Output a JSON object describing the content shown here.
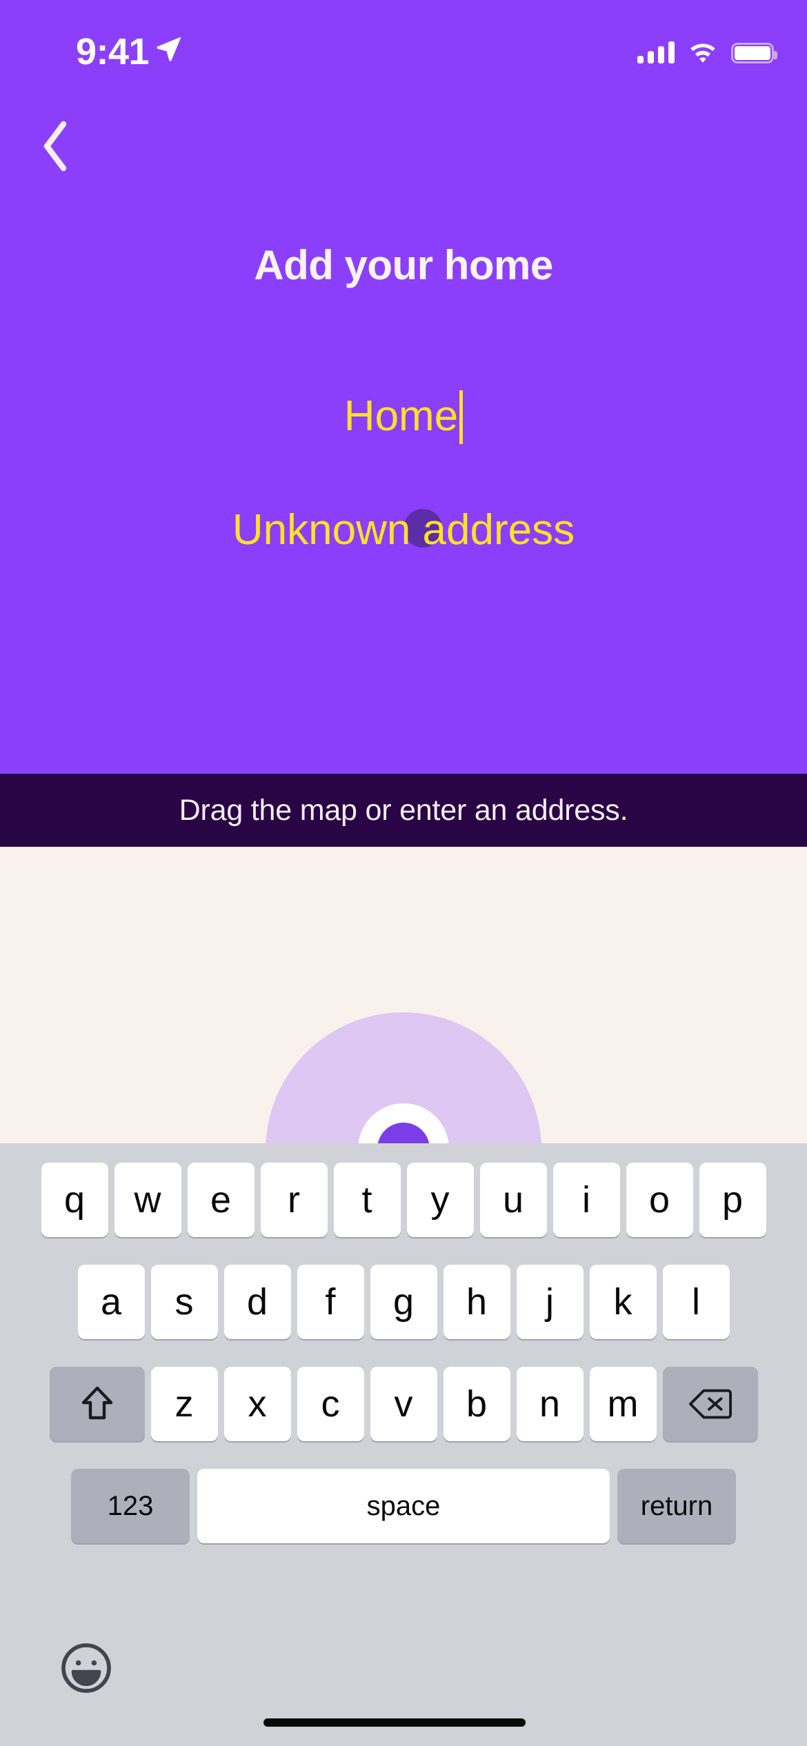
{
  "status_bar": {
    "time": "9:41",
    "location_icon": "location-arrow-icon",
    "cellular_icon": "cellular-signal-icon",
    "wifi_icon": "wifi-icon",
    "battery_icon": "battery-full-icon"
  },
  "navigation": {
    "back_icon": "chevron-left-icon"
  },
  "header": {
    "title": "Add your home"
  },
  "form": {
    "name_value": "Home",
    "address_value": "Unknown address"
  },
  "banner": {
    "text": "Drag the map or enter an address."
  },
  "map": {
    "user_location_icon": "user-location-dot"
  },
  "keyboard": {
    "row1": [
      "q",
      "w",
      "e",
      "r",
      "t",
      "y",
      "u",
      "i",
      "o",
      "p"
    ],
    "row2": [
      "a",
      "s",
      "d",
      "f",
      "g",
      "h",
      "j",
      "k",
      "l"
    ],
    "row3": [
      "z",
      "x",
      "c",
      "v",
      "b",
      "n",
      "m"
    ],
    "shift_icon": "shift-arrow-icon",
    "backspace_icon": "backspace-delete-icon",
    "numeric_label": "123",
    "space_label": "space",
    "return_label": "return",
    "emoji_icon": "emoji-smiley-icon"
  },
  "colors": {
    "brand_purple": "#8B3FFA",
    "accent_yellow": "#FFE224",
    "banner_dark": "#2A0545",
    "map_background": "#F9F2EC",
    "keyboard_background": "#D1D2D8",
    "accuracy_circle": "#DEC7F2",
    "user_dot": "#7B3DE8"
  }
}
